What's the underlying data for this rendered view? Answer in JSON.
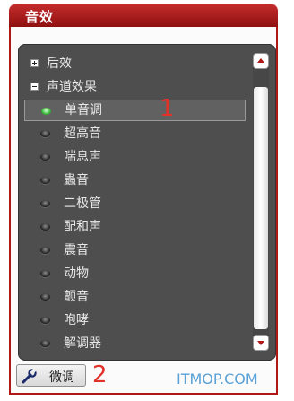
{
  "window": {
    "title": "音效"
  },
  "tree": {
    "groups": [
      {
        "label": "后效",
        "expanded": false
      },
      {
        "label": "声道效果",
        "expanded": true
      }
    ],
    "items": [
      {
        "label": "单音调",
        "selected": true
      },
      {
        "label": "超高音",
        "selected": false
      },
      {
        "label": "喘息声",
        "selected": false
      },
      {
        "label": "蟲音",
        "selected": false
      },
      {
        "label": "二极管",
        "selected": false
      },
      {
        "label": "配和声",
        "selected": false
      },
      {
        "label": "震音",
        "selected": false
      },
      {
        "label": "动物",
        "selected": false
      },
      {
        "label": "颤音",
        "selected": false
      },
      {
        "label": "咆哮",
        "selected": false
      },
      {
        "label": "解调器",
        "selected": false
      }
    ]
  },
  "buttons": {
    "fine_tune": "微调"
  },
  "annotations": {
    "marker_1": "1",
    "marker_2": "2"
  },
  "watermark": "ITMOP.COM",
  "colors": {
    "title_bar": "#a81c1c",
    "panel": "#4e4e4e",
    "active_radio": "#3fbf3f",
    "marker": "#e0322a"
  }
}
